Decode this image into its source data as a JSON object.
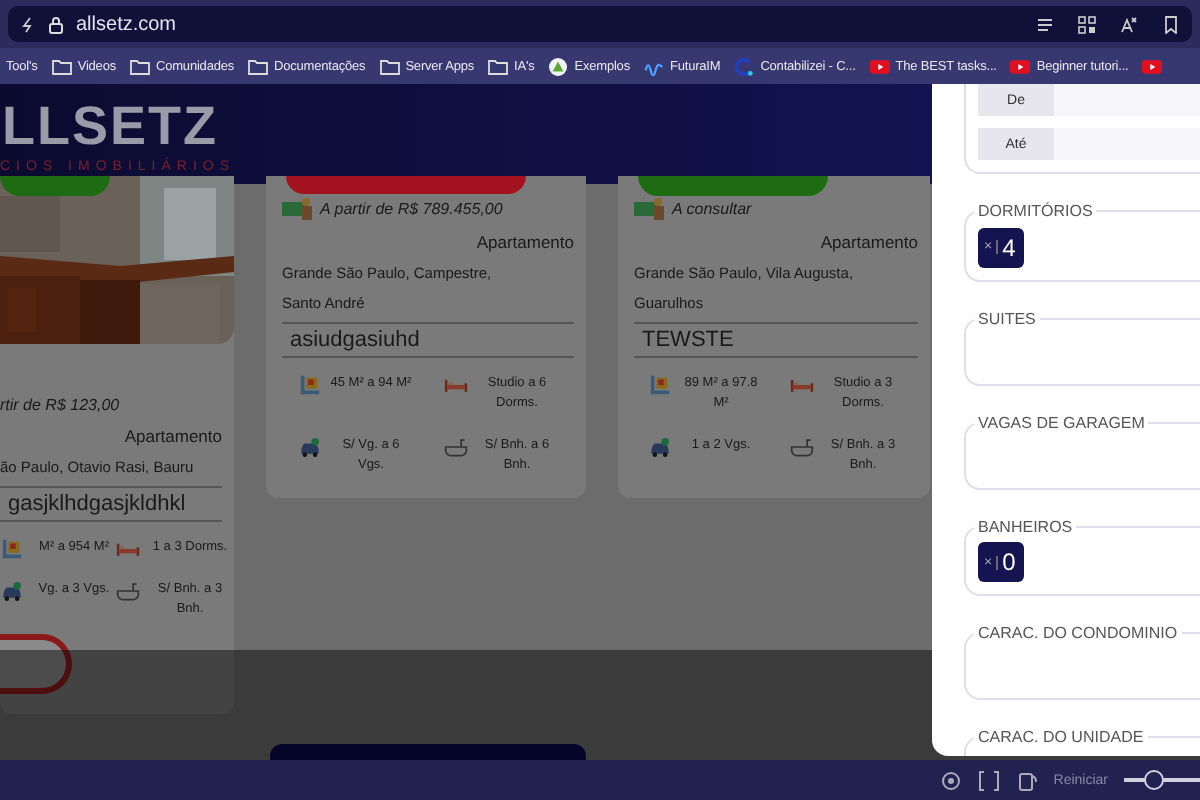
{
  "browser": {
    "address": "allsetz.com",
    "bookmarks": [
      {
        "label": "Tool's",
        "kind": "plain"
      },
      {
        "label": "Videos",
        "kind": "folder"
      },
      {
        "label": "Comunidades",
        "kind": "folder"
      },
      {
        "label": "Documentações",
        "kind": "folder"
      },
      {
        "label": "Server Apps",
        "kind": "folder"
      },
      {
        "label": "IA's",
        "kind": "folder"
      },
      {
        "label": "Exemplos",
        "kind": "app"
      },
      {
        "label": "FuturaIM",
        "kind": "brand"
      },
      {
        "label": "Contabilizei - C...",
        "kind": "site"
      },
      {
        "label": "The BEST tasks...",
        "kind": "video"
      },
      {
        "label": "Beginner tutori...",
        "kind": "video"
      },
      {
        "kind": "video"
      }
    ]
  },
  "site": {
    "logo": "LLSETZ",
    "tagline": "CIOS IMOBILIÁRIOS"
  },
  "cards": [
    {
      "badge": {
        "color": "#1f6b12"
      },
      "photo": {
        "kind": "picture"
      },
      "price": "rtir de R$ 123,00",
      "type": "Apartamento",
      "location": [
        "ão Paulo, Otavio Rasi, Bauru"
      ],
      "title": "gasjklhdgasjkldhkl",
      "features": [
        {
          "kind": "area",
          "text": "M² a 954 M²"
        },
        {
          "kind": "bed",
          "text": "1 a 3 Dorms."
        },
        {
          "kind": "car",
          "text": "Vg. a 3 Vgs."
        },
        {
          "kind": "bath",
          "text": "S/ Bnh. a 3 Bnh."
        }
      ],
      "action": true
    },
    {
      "badge": {
        "color": "#a3121f"
      },
      "price": "A partir de R$ 789.455,00",
      "type": "Apartamento",
      "location": [
        "Grande São Paulo, Campestre,",
        "Santo André"
      ],
      "title": "asiudgasiuhd",
      "features": [
        {
          "kind": "area",
          "text": "45 M² a 94 M²"
        },
        {
          "kind": "bed",
          "text": "Studio a 6 Dorms."
        },
        {
          "kind": "car",
          "text": "S/ Vg. a 6 Vgs."
        },
        {
          "kind": "bath",
          "text": "S/ Bnh. a 6 Bnh."
        }
      ],
      "action": false
    },
    {
      "badge": {
        "color": "#1f6b12"
      },
      "price": "A consultar",
      "type": "Apartamento",
      "location": [
        "Grande São Paulo, Vila Augusta,",
        "Guarulhos"
      ],
      "title": "TEWSTE",
      "features": [
        {
          "kind": "area",
          "text": "89 M² a 97.8 M²"
        },
        {
          "kind": "bed",
          "text": "Studio a 3 Dorms."
        },
        {
          "kind": "car",
          "text": "1 a 2 Vgs."
        },
        {
          "kind": "bath",
          "text": "S/ Bnh. a 3 Bnh."
        }
      ],
      "action": false
    }
  ],
  "filter_panel": {
    "price": [
      {
        "label": "De"
      },
      {
        "label": "Até"
      }
    ],
    "groups": [
      {
        "legend": "DORMITÓRIOS",
        "chips": [
          {
            "remove": "×",
            "value": "4"
          }
        ]
      },
      {
        "legend": "SUITES"
      },
      {
        "legend": "VAGAS DE GARAGEM"
      },
      {
        "legend": "BANHEIROS",
        "chips": [
          {
            "remove": "×",
            "value": "0"
          }
        ]
      },
      {
        "legend": "CARAC. DO CONDOMINIO"
      },
      {
        "legend": "CARAC. DO UNIDADE"
      }
    ]
  },
  "bottom_bar": {
    "reset": "Reiniciar",
    "zoom": {
      "level": 0.4
    }
  }
}
